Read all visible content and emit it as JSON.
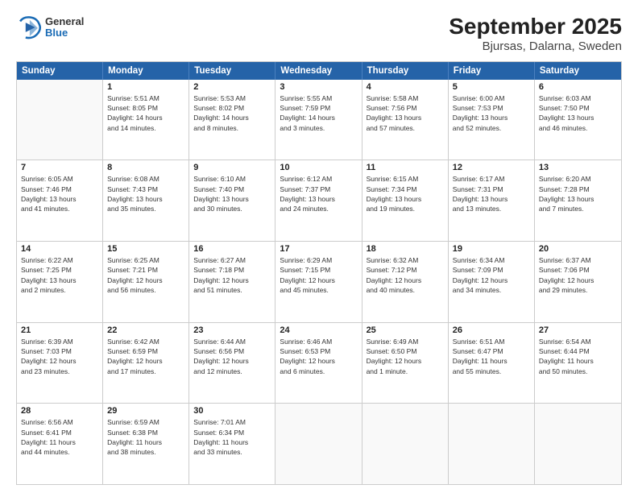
{
  "logo": {
    "general": "General",
    "blue": "Blue"
  },
  "title": "September 2025",
  "subtitle": "Bjursas, Dalarna, Sweden",
  "header_days": [
    "Sunday",
    "Monday",
    "Tuesday",
    "Wednesday",
    "Thursday",
    "Friday",
    "Saturday"
  ],
  "weeks": [
    [
      {
        "day": "",
        "text": ""
      },
      {
        "day": "1",
        "text": "Sunrise: 5:51 AM\nSunset: 8:05 PM\nDaylight: 14 hours\nand 14 minutes."
      },
      {
        "day": "2",
        "text": "Sunrise: 5:53 AM\nSunset: 8:02 PM\nDaylight: 14 hours\nand 8 minutes."
      },
      {
        "day": "3",
        "text": "Sunrise: 5:55 AM\nSunset: 7:59 PM\nDaylight: 14 hours\nand 3 minutes."
      },
      {
        "day": "4",
        "text": "Sunrise: 5:58 AM\nSunset: 7:56 PM\nDaylight: 13 hours\nand 57 minutes."
      },
      {
        "day": "5",
        "text": "Sunrise: 6:00 AM\nSunset: 7:53 PM\nDaylight: 13 hours\nand 52 minutes."
      },
      {
        "day": "6",
        "text": "Sunrise: 6:03 AM\nSunset: 7:50 PM\nDaylight: 13 hours\nand 46 minutes."
      }
    ],
    [
      {
        "day": "7",
        "text": "Sunrise: 6:05 AM\nSunset: 7:46 PM\nDaylight: 13 hours\nand 41 minutes."
      },
      {
        "day": "8",
        "text": "Sunrise: 6:08 AM\nSunset: 7:43 PM\nDaylight: 13 hours\nand 35 minutes."
      },
      {
        "day": "9",
        "text": "Sunrise: 6:10 AM\nSunset: 7:40 PM\nDaylight: 13 hours\nand 30 minutes."
      },
      {
        "day": "10",
        "text": "Sunrise: 6:12 AM\nSunset: 7:37 PM\nDaylight: 13 hours\nand 24 minutes."
      },
      {
        "day": "11",
        "text": "Sunrise: 6:15 AM\nSunset: 7:34 PM\nDaylight: 13 hours\nand 19 minutes."
      },
      {
        "day": "12",
        "text": "Sunrise: 6:17 AM\nSunset: 7:31 PM\nDaylight: 13 hours\nand 13 minutes."
      },
      {
        "day": "13",
        "text": "Sunrise: 6:20 AM\nSunset: 7:28 PM\nDaylight: 13 hours\nand 7 minutes."
      }
    ],
    [
      {
        "day": "14",
        "text": "Sunrise: 6:22 AM\nSunset: 7:25 PM\nDaylight: 13 hours\nand 2 minutes."
      },
      {
        "day": "15",
        "text": "Sunrise: 6:25 AM\nSunset: 7:21 PM\nDaylight: 12 hours\nand 56 minutes."
      },
      {
        "day": "16",
        "text": "Sunrise: 6:27 AM\nSunset: 7:18 PM\nDaylight: 12 hours\nand 51 minutes."
      },
      {
        "day": "17",
        "text": "Sunrise: 6:29 AM\nSunset: 7:15 PM\nDaylight: 12 hours\nand 45 minutes."
      },
      {
        "day": "18",
        "text": "Sunrise: 6:32 AM\nSunset: 7:12 PM\nDaylight: 12 hours\nand 40 minutes."
      },
      {
        "day": "19",
        "text": "Sunrise: 6:34 AM\nSunset: 7:09 PM\nDaylight: 12 hours\nand 34 minutes."
      },
      {
        "day": "20",
        "text": "Sunrise: 6:37 AM\nSunset: 7:06 PM\nDaylight: 12 hours\nand 29 minutes."
      }
    ],
    [
      {
        "day": "21",
        "text": "Sunrise: 6:39 AM\nSunset: 7:03 PM\nDaylight: 12 hours\nand 23 minutes."
      },
      {
        "day": "22",
        "text": "Sunrise: 6:42 AM\nSunset: 6:59 PM\nDaylight: 12 hours\nand 17 minutes."
      },
      {
        "day": "23",
        "text": "Sunrise: 6:44 AM\nSunset: 6:56 PM\nDaylight: 12 hours\nand 12 minutes."
      },
      {
        "day": "24",
        "text": "Sunrise: 6:46 AM\nSunset: 6:53 PM\nDaylight: 12 hours\nand 6 minutes."
      },
      {
        "day": "25",
        "text": "Sunrise: 6:49 AM\nSunset: 6:50 PM\nDaylight: 12 hours\nand 1 minute."
      },
      {
        "day": "26",
        "text": "Sunrise: 6:51 AM\nSunset: 6:47 PM\nDaylight: 11 hours\nand 55 minutes."
      },
      {
        "day": "27",
        "text": "Sunrise: 6:54 AM\nSunset: 6:44 PM\nDaylight: 11 hours\nand 50 minutes."
      }
    ],
    [
      {
        "day": "28",
        "text": "Sunrise: 6:56 AM\nSunset: 6:41 PM\nDaylight: 11 hours\nand 44 minutes."
      },
      {
        "day": "29",
        "text": "Sunrise: 6:59 AM\nSunset: 6:38 PM\nDaylight: 11 hours\nand 38 minutes."
      },
      {
        "day": "30",
        "text": "Sunrise: 7:01 AM\nSunset: 6:34 PM\nDaylight: 11 hours\nand 33 minutes."
      },
      {
        "day": "",
        "text": ""
      },
      {
        "day": "",
        "text": ""
      },
      {
        "day": "",
        "text": ""
      },
      {
        "day": "",
        "text": ""
      }
    ]
  ]
}
